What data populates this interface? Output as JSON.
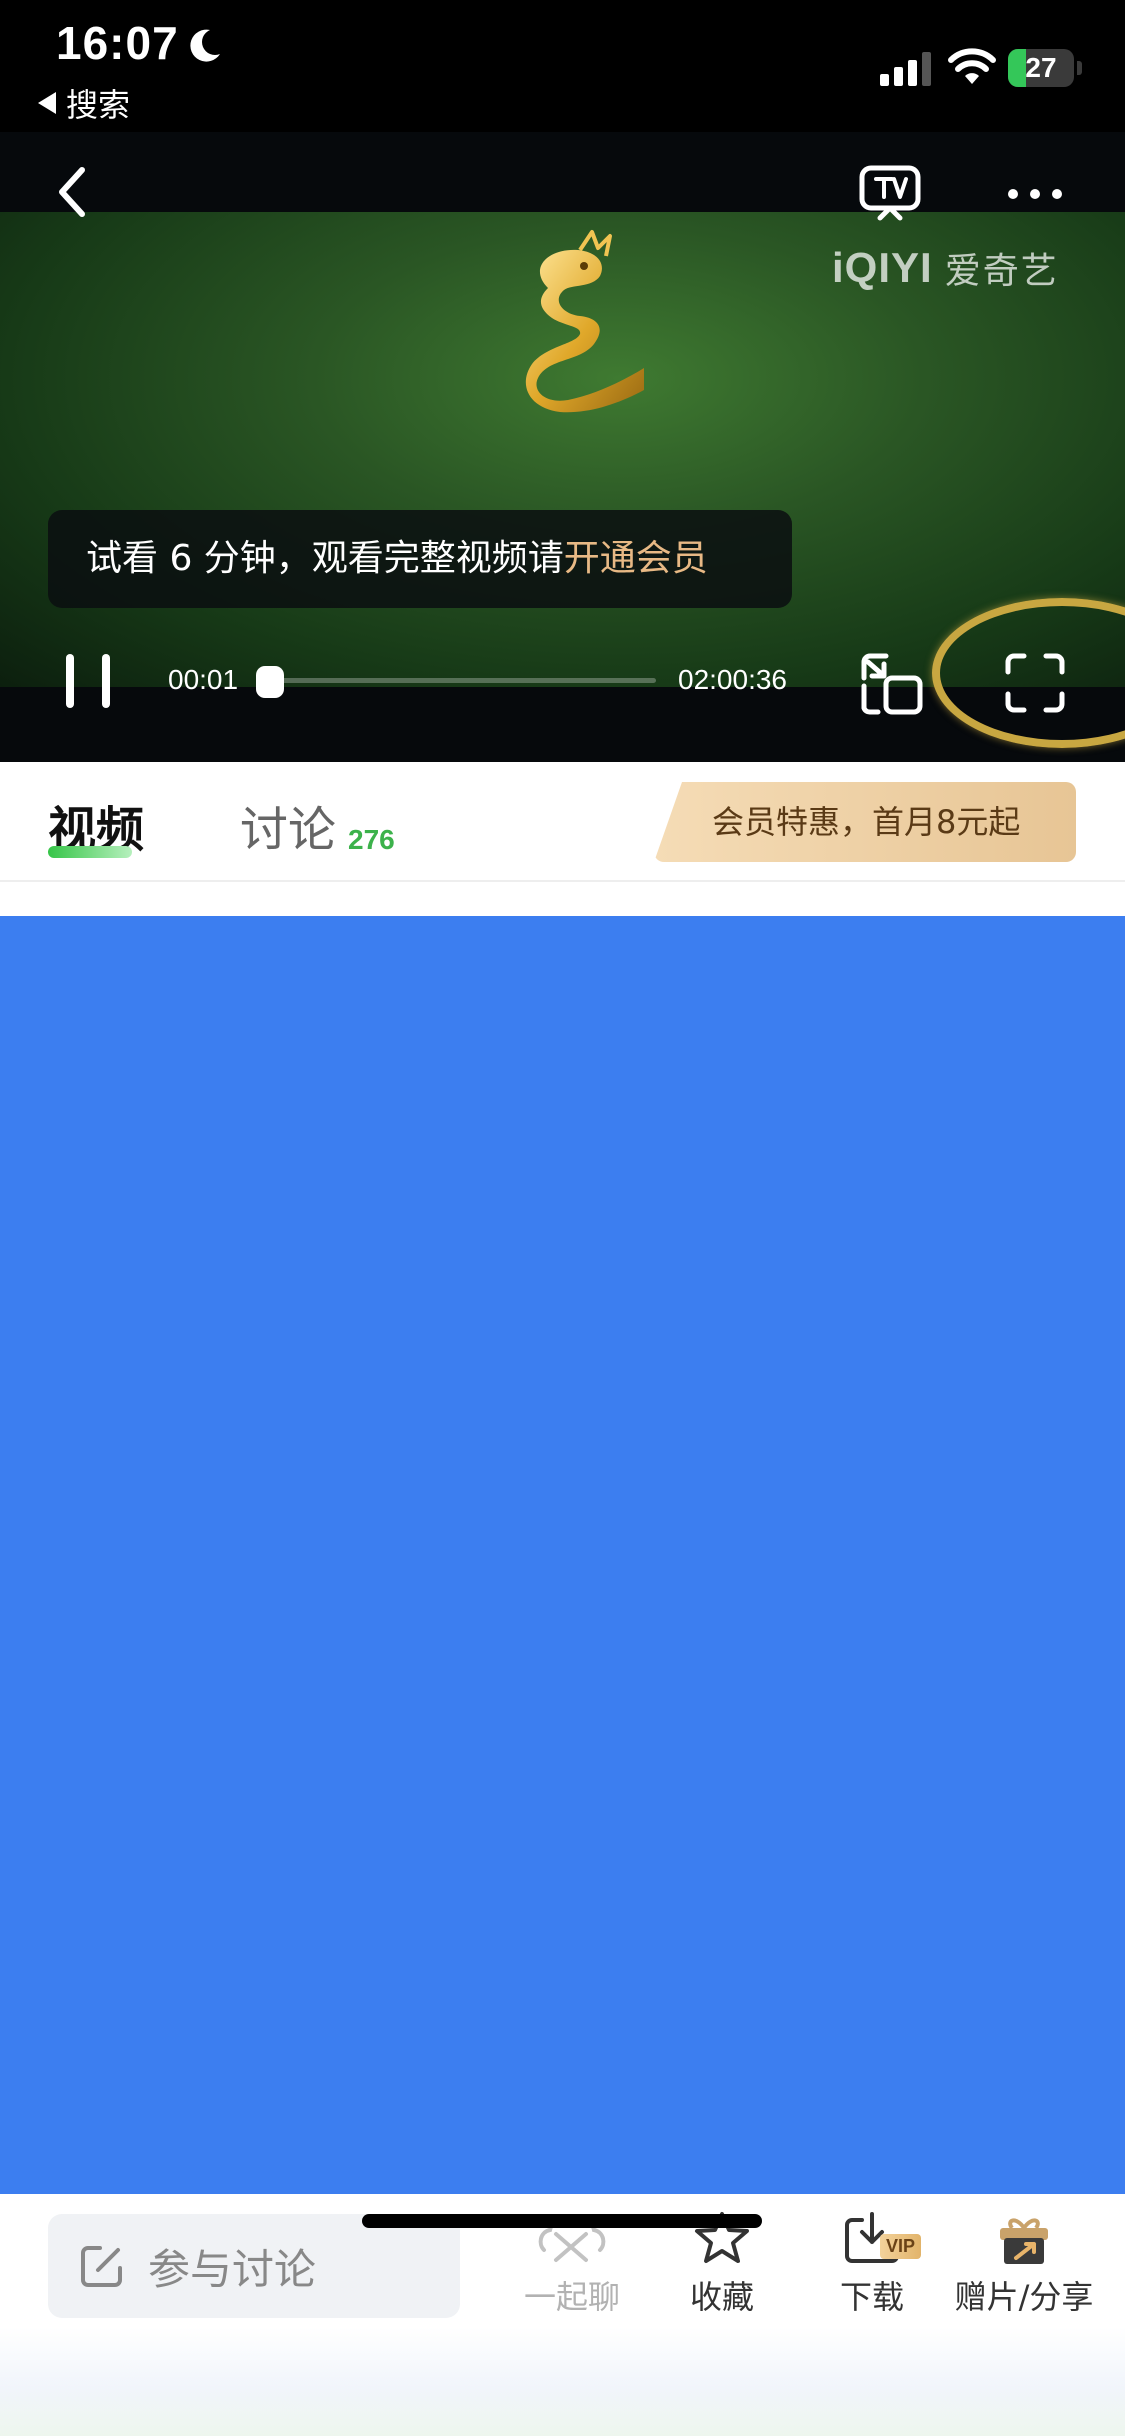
{
  "status_bar": {
    "time": "16:07",
    "back_app_label": "搜索",
    "battery_level": "27",
    "battery_fraction": 0.27
  },
  "player": {
    "watermark_latin": "iQIYI",
    "watermark_cn": "爱奇艺",
    "trial_text": "试看 6 分钟，观看完整视频请",
    "trial_link": "开通会员",
    "current_time": "00:01",
    "total_time": "02:00:36",
    "progress_fraction": 0.0001
  },
  "tabs": {
    "video": "视频",
    "discuss": "讨论",
    "discuss_count": "276",
    "vip_promo": "会员特惠，首月8元起"
  },
  "bottom_bar": {
    "input_placeholder": "参与讨论",
    "chat": "一起聊",
    "favorite": "收藏",
    "download": "下载",
    "download_badge": "VIP",
    "share": "赠片/分享"
  },
  "colors": {
    "accent_green": "#3cb24b",
    "gold": "#e8b985",
    "content_blue": "#3c7ef0"
  }
}
